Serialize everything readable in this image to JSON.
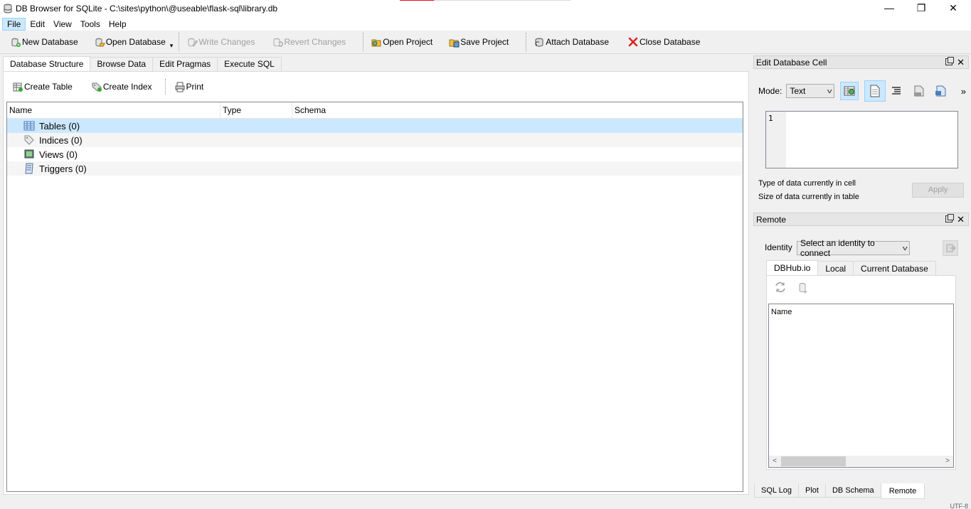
{
  "window": {
    "title": "DB Browser for SQLite - C:\\sites\\python\\@useable\\flask-sql\\library.db",
    "minimize_glyph": "—",
    "restore_glyph": "❐",
    "close_glyph": "✕"
  },
  "menu": [
    "File",
    "Edit",
    "View",
    "Tools",
    "Help"
  ],
  "toolbar": {
    "new_database": "New Database",
    "open_database": "Open Database",
    "write_changes": "Write Changes",
    "revert_changes": "Revert Changes",
    "open_project": "Open Project",
    "save_project": "Save Project",
    "attach_database": "Attach Database",
    "close_database": "Close Database"
  },
  "main_tabs": [
    "Database Structure",
    "Browse Data",
    "Edit Pragmas",
    "Execute SQL"
  ],
  "structure": {
    "create_table": "Create Table",
    "create_index": "Create Index",
    "print": "Print",
    "columns": [
      "Name",
      "Type",
      "Schema"
    ],
    "rows": [
      {
        "label": "Tables (0)",
        "icon": "table-icon"
      },
      {
        "label": "Indices (0)",
        "icon": "index-icon"
      },
      {
        "label": "Views (0)",
        "icon": "view-icon"
      },
      {
        "label": "Triggers (0)",
        "icon": "trigger-icon"
      }
    ]
  },
  "edit_cell": {
    "title": "Edit Database Cell",
    "mode_label": "Mode:",
    "mode_value": "Text",
    "line_number": "1",
    "type_info": "Type of data currently in cell",
    "size_info": "Size of data currently in table",
    "apply": "Apply",
    "more": "»"
  },
  "remote": {
    "title": "Remote",
    "identity_label": "Identity",
    "identity_value": "Select an identity to connect",
    "tabs": [
      "DBHub.io",
      "Local",
      "Current Database"
    ],
    "list_header": "Name"
  },
  "bottom_tabs": [
    "SQL Log",
    "Plot",
    "DB Schema",
    "Remote"
  ],
  "status_right": "UTF-8"
}
